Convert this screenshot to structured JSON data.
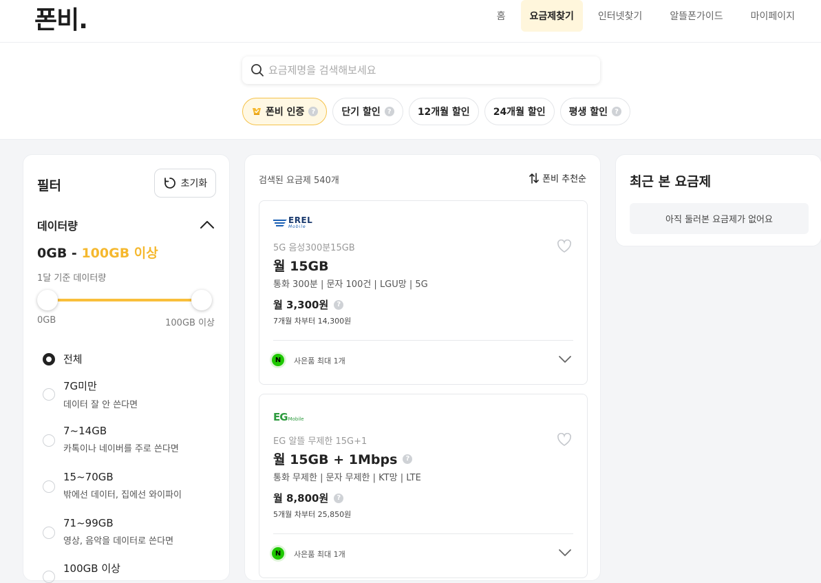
{
  "brand": {
    "logo": "폰비."
  },
  "nav": {
    "items": [
      "홈",
      "요금제찾기",
      "인터넷찾기",
      "알뜰폰가이드",
      "마이페이지"
    ],
    "active": "요금제찾기"
  },
  "search": {
    "placeholder": "요금제명을 검색해보세요"
  },
  "chips": [
    {
      "label": "폰비 인증",
      "help": "?"
    },
    {
      "label": "단기 할인",
      "help": "?"
    },
    {
      "label": "12개월 할인"
    },
    {
      "label": "24개월 할인"
    },
    {
      "label": "평생 할인",
      "help": "?"
    }
  ],
  "filter": {
    "title": "필터",
    "reset_label": "초기화",
    "data_section": {
      "title": "데이터량",
      "range_min": "0GB",
      "range_sep": " - ",
      "range_max": "100GB 이상",
      "sublabel": "1달 기준 데이터량",
      "slider_min_label": "0GB",
      "slider_max_label": "100GB 이상"
    },
    "options": [
      {
        "label": "전체",
        "desc": "",
        "checked": true
      },
      {
        "label": "7G미만",
        "desc": "데이터 잘 안 쓴다면",
        "checked": false
      },
      {
        "label": "7~14GB",
        "desc": "카톡이나 네이버를 주로 쓴다면",
        "checked": false
      },
      {
        "label": "15~70GB",
        "desc": "밖에선 데이터, 집에선 와이파이",
        "checked": false
      },
      {
        "label": "71~99GB",
        "desc": "영상, 음악을 데이터로 쓴다면",
        "checked": false
      },
      {
        "label": "100GB 이상",
        "desc": "",
        "checked": false
      }
    ]
  },
  "results": {
    "count_label": "검색된 요금제 540개",
    "sort_label": "폰비 추천순",
    "plans": [
      {
        "carrier": "EREL",
        "carrier_sub": "Mobile",
        "subtitle": "5G 음성300분15GB",
        "name": "월 15GB",
        "spec": "통화 300분 | 문자 100건 | LGU망 | 5G",
        "price": "월 3,300원",
        "after": "7개월 차부터 14,300원",
        "gift": "사은품 최대 1개"
      },
      {
        "carrier": "EG",
        "carrier_sub": "Mobile",
        "subtitle": "EG 알뜰 무제한 15G+1",
        "name": "월 15GB + 1Mbps",
        "spec": "통화 무제한 | 문자 무제한 | KT망 | LTE",
        "price": "월 8,800원",
        "after": "5개월 차부터 25,850원",
        "gift": "사은품 최대 1개"
      }
    ]
  },
  "recent": {
    "title": "최근 본 요금제",
    "empty": "아직 둘러본 요금제가 없어요"
  },
  "colors": {
    "accent": "#f9bf3b",
    "accent_bg": "#fff6dc",
    "gift": "#1ec800",
    "erel_blue": "#1a5fb4",
    "eg_green": "#2e9b3f"
  }
}
